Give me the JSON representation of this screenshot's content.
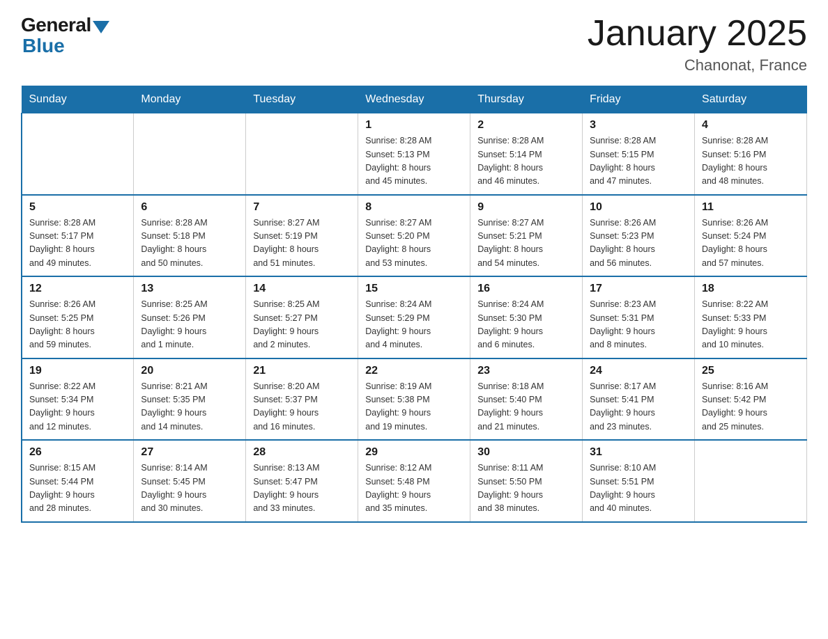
{
  "header": {
    "logo_general": "General",
    "logo_blue": "Blue",
    "title": "January 2025",
    "subtitle": "Chanonat, France"
  },
  "weekdays": [
    "Sunday",
    "Monday",
    "Tuesday",
    "Wednesday",
    "Thursday",
    "Friday",
    "Saturday"
  ],
  "weeks": [
    [
      {
        "day": "",
        "info": ""
      },
      {
        "day": "",
        "info": ""
      },
      {
        "day": "",
        "info": ""
      },
      {
        "day": "1",
        "info": "Sunrise: 8:28 AM\nSunset: 5:13 PM\nDaylight: 8 hours\nand 45 minutes."
      },
      {
        "day": "2",
        "info": "Sunrise: 8:28 AM\nSunset: 5:14 PM\nDaylight: 8 hours\nand 46 minutes."
      },
      {
        "day": "3",
        "info": "Sunrise: 8:28 AM\nSunset: 5:15 PM\nDaylight: 8 hours\nand 47 minutes."
      },
      {
        "day": "4",
        "info": "Sunrise: 8:28 AM\nSunset: 5:16 PM\nDaylight: 8 hours\nand 48 minutes."
      }
    ],
    [
      {
        "day": "5",
        "info": "Sunrise: 8:28 AM\nSunset: 5:17 PM\nDaylight: 8 hours\nand 49 minutes."
      },
      {
        "day": "6",
        "info": "Sunrise: 8:28 AM\nSunset: 5:18 PM\nDaylight: 8 hours\nand 50 minutes."
      },
      {
        "day": "7",
        "info": "Sunrise: 8:27 AM\nSunset: 5:19 PM\nDaylight: 8 hours\nand 51 minutes."
      },
      {
        "day": "8",
        "info": "Sunrise: 8:27 AM\nSunset: 5:20 PM\nDaylight: 8 hours\nand 53 minutes."
      },
      {
        "day": "9",
        "info": "Sunrise: 8:27 AM\nSunset: 5:21 PM\nDaylight: 8 hours\nand 54 minutes."
      },
      {
        "day": "10",
        "info": "Sunrise: 8:26 AM\nSunset: 5:23 PM\nDaylight: 8 hours\nand 56 minutes."
      },
      {
        "day": "11",
        "info": "Sunrise: 8:26 AM\nSunset: 5:24 PM\nDaylight: 8 hours\nand 57 minutes."
      }
    ],
    [
      {
        "day": "12",
        "info": "Sunrise: 8:26 AM\nSunset: 5:25 PM\nDaylight: 8 hours\nand 59 minutes."
      },
      {
        "day": "13",
        "info": "Sunrise: 8:25 AM\nSunset: 5:26 PM\nDaylight: 9 hours\nand 1 minute."
      },
      {
        "day": "14",
        "info": "Sunrise: 8:25 AM\nSunset: 5:27 PM\nDaylight: 9 hours\nand 2 minutes."
      },
      {
        "day": "15",
        "info": "Sunrise: 8:24 AM\nSunset: 5:29 PM\nDaylight: 9 hours\nand 4 minutes."
      },
      {
        "day": "16",
        "info": "Sunrise: 8:24 AM\nSunset: 5:30 PM\nDaylight: 9 hours\nand 6 minutes."
      },
      {
        "day": "17",
        "info": "Sunrise: 8:23 AM\nSunset: 5:31 PM\nDaylight: 9 hours\nand 8 minutes."
      },
      {
        "day": "18",
        "info": "Sunrise: 8:22 AM\nSunset: 5:33 PM\nDaylight: 9 hours\nand 10 minutes."
      }
    ],
    [
      {
        "day": "19",
        "info": "Sunrise: 8:22 AM\nSunset: 5:34 PM\nDaylight: 9 hours\nand 12 minutes."
      },
      {
        "day": "20",
        "info": "Sunrise: 8:21 AM\nSunset: 5:35 PM\nDaylight: 9 hours\nand 14 minutes."
      },
      {
        "day": "21",
        "info": "Sunrise: 8:20 AM\nSunset: 5:37 PM\nDaylight: 9 hours\nand 16 minutes."
      },
      {
        "day": "22",
        "info": "Sunrise: 8:19 AM\nSunset: 5:38 PM\nDaylight: 9 hours\nand 19 minutes."
      },
      {
        "day": "23",
        "info": "Sunrise: 8:18 AM\nSunset: 5:40 PM\nDaylight: 9 hours\nand 21 minutes."
      },
      {
        "day": "24",
        "info": "Sunrise: 8:17 AM\nSunset: 5:41 PM\nDaylight: 9 hours\nand 23 minutes."
      },
      {
        "day": "25",
        "info": "Sunrise: 8:16 AM\nSunset: 5:42 PM\nDaylight: 9 hours\nand 25 minutes."
      }
    ],
    [
      {
        "day": "26",
        "info": "Sunrise: 8:15 AM\nSunset: 5:44 PM\nDaylight: 9 hours\nand 28 minutes."
      },
      {
        "day": "27",
        "info": "Sunrise: 8:14 AM\nSunset: 5:45 PM\nDaylight: 9 hours\nand 30 minutes."
      },
      {
        "day": "28",
        "info": "Sunrise: 8:13 AM\nSunset: 5:47 PM\nDaylight: 9 hours\nand 33 minutes."
      },
      {
        "day": "29",
        "info": "Sunrise: 8:12 AM\nSunset: 5:48 PM\nDaylight: 9 hours\nand 35 minutes."
      },
      {
        "day": "30",
        "info": "Sunrise: 8:11 AM\nSunset: 5:50 PM\nDaylight: 9 hours\nand 38 minutes."
      },
      {
        "day": "31",
        "info": "Sunrise: 8:10 AM\nSunset: 5:51 PM\nDaylight: 9 hours\nand 40 minutes."
      },
      {
        "day": "",
        "info": ""
      }
    ]
  ]
}
